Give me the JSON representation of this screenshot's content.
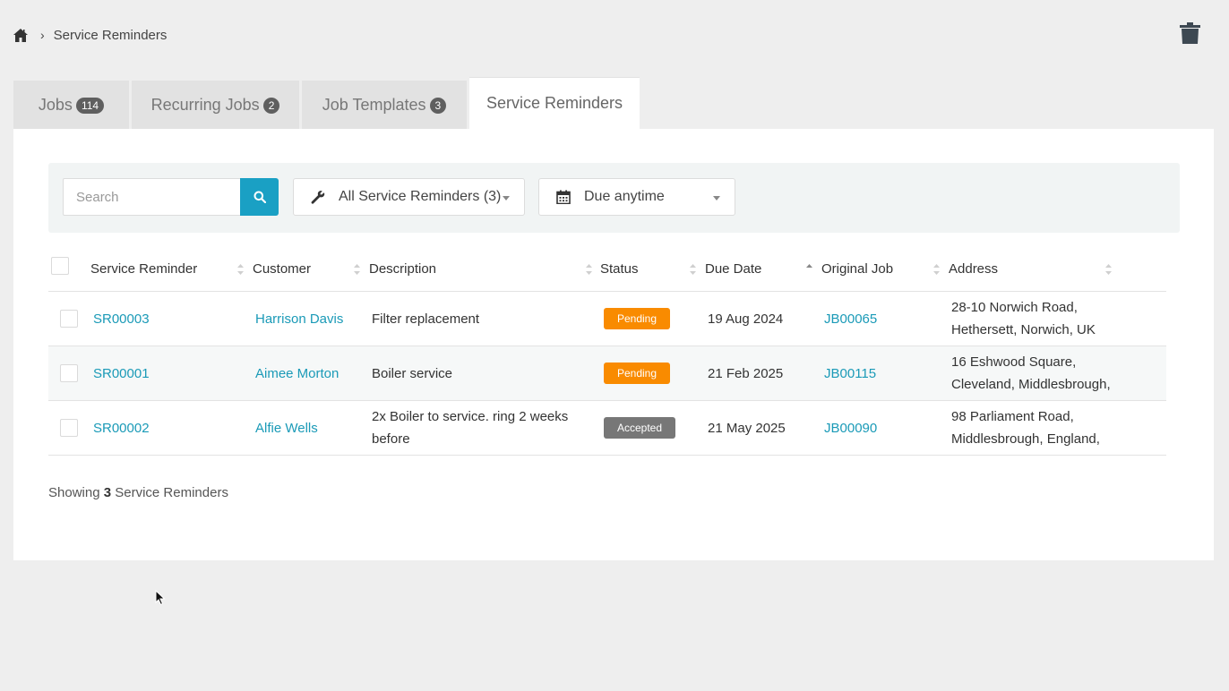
{
  "breadcrumb": {
    "separator": "›",
    "current": "Service Reminders"
  },
  "tabs": [
    {
      "label": "Jobs",
      "badge": "114"
    },
    {
      "label": "Recurring Jobs",
      "badge": "2"
    },
    {
      "label": "Job Templates",
      "badge": "3"
    },
    {
      "label": "Service Reminders",
      "badge": ""
    }
  ],
  "filters": {
    "search_placeholder": "Search",
    "type_filter": "All Service Reminders (3)",
    "date_filter": "Due anytime"
  },
  "columns": {
    "service_reminder": "Service Reminder",
    "customer": "Customer",
    "description": "Description",
    "status": "Status",
    "due_date": "Due Date",
    "original_job": "Original Job",
    "address": "Address"
  },
  "rows": [
    {
      "id": "SR00003",
      "customer": "Harrison Davis",
      "description": "Filter replacement",
      "status": "Pending",
      "due_date": "19 Aug 2024",
      "original_job": "JB00065",
      "address_line1": "28-10 Norwich Road,",
      "address_line2": "Hethersett, Norwich, UK"
    },
    {
      "id": "SR00001",
      "customer": "Aimee Morton",
      "description": "Boiler service",
      "status": "Pending",
      "due_date": "21 Feb 2025",
      "original_job": "JB00115",
      "address_line1": "16 Eshwood Square,",
      "address_line2": "Cleveland, Middlesbrough,"
    },
    {
      "id": "SR00002",
      "customer": "Alfie Wells",
      "description": "2x Boiler to service. ring 2 weeks before",
      "status": "Accepted",
      "due_date": "21 May 2025",
      "original_job": "JB00090",
      "address_line1": "98 Parliament Road,",
      "address_line2": "Middlesbrough, England,"
    }
  ],
  "footer": {
    "prefix": "Showing",
    "count": "3",
    "suffix": "Service Reminders"
  },
  "colors": {
    "accent": "#1aa0c4",
    "link": "#1a9ab7",
    "pending": "#f98b00",
    "accepted": "#777777"
  },
  "icons": {
    "home": "home-icon",
    "trash": "trash-icon",
    "search": "search-icon",
    "wrench": "wrench-icon",
    "calendar": "calendar-icon"
  }
}
